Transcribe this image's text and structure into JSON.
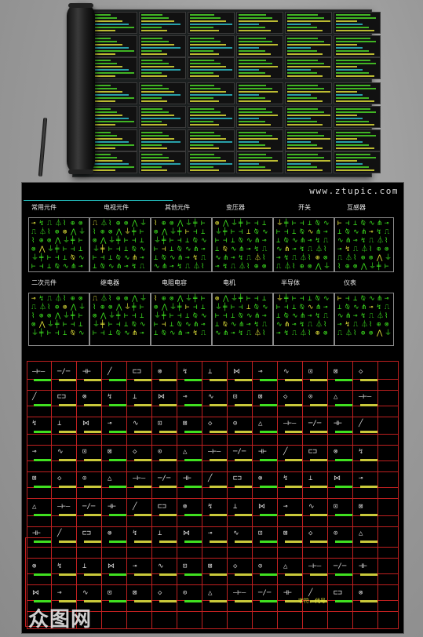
{
  "watermark_url": "www.ztupic.com",
  "brand": "众图网",
  "categories_row1": [
    "常用元件",
    "电视元件",
    "其他元件",
    "变压器",
    "开关",
    "互感器"
  ],
  "categories_row2": [
    "二次元件",
    "继电器",
    "电阻电容",
    "电机",
    "半导体",
    "仪表"
  ],
  "table_section_title": "字符、代号",
  "colors": {
    "sheet_bg": "#000000",
    "symbol_green": "#3de51f",
    "symbol_yellow": "#e5e53a",
    "grid_red": "#c02020"
  },
  "icons": [
    "cad-roll-icon",
    "pen-icon"
  ]
}
